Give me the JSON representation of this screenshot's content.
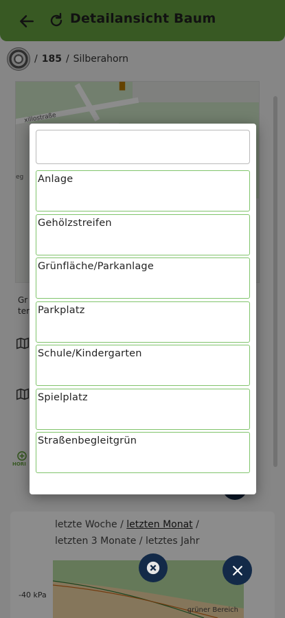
{
  "header": {
    "title": "Detailansicht Baum"
  },
  "breadcrumb": {
    "sep1": "/",
    "number": "185",
    "sep2": "/",
    "species": "Silberahorn"
  },
  "map": {
    "street_label": "xillostraße",
    "side_label": "eg"
  },
  "background": {
    "text_line1": "Gr",
    "text_line2": "ter",
    "hidden_label": "HORI"
  },
  "chart": {
    "periods": {
      "week": "letzte Woche",
      "sep1": " / ",
      "month": "letzten Monat",
      "sep2": " /",
      "three_months": "letzten 3 Monate",
      "sep3": " / ",
      "year": "letztes Jahr"
    },
    "y_label": "-40 kPa",
    "area_label": "grüner Bereich"
  },
  "dialog": {
    "search_value": "",
    "options": [
      "Anlage",
      "Gehölzstreifen",
      "Grünfläche/Parkanlage",
      "Parkplatz",
      "Schule/Kindergarten",
      "Spielplatz",
      "Straßenbegleitgrün"
    ]
  },
  "colors": {
    "header": "#67a341",
    "option_border": "#7fc36a",
    "fab": "#132a48"
  }
}
